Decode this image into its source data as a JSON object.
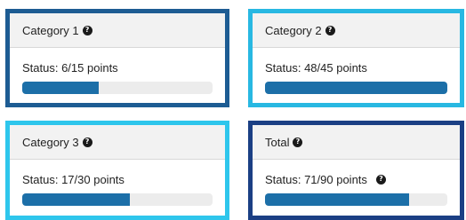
{
  "cards": [
    {
      "title": "Category 1",
      "status": "Status: 6/15 points",
      "progress": 0.4,
      "show_status_help": false
    },
    {
      "title": "Category 2",
      "status": "Status: 48/45 points",
      "progress": 1.0,
      "show_status_help": false
    },
    {
      "title": "Category 3",
      "status": "Status: 17/30 points",
      "progress": 0.567,
      "show_status_help": false
    },
    {
      "title": "Total",
      "status": "Status: 71/90 points",
      "progress": 0.789,
      "show_status_help": true
    }
  ],
  "help_glyph": "?",
  "colors": {
    "category1_border": "#1d5c93",
    "category2_border": "#28b8e2",
    "category3_border": "#2ec6ec",
    "total_border": "#1b3f84",
    "progress_fill": "#1c6fa8",
    "progress_track": "#ececec"
  }
}
